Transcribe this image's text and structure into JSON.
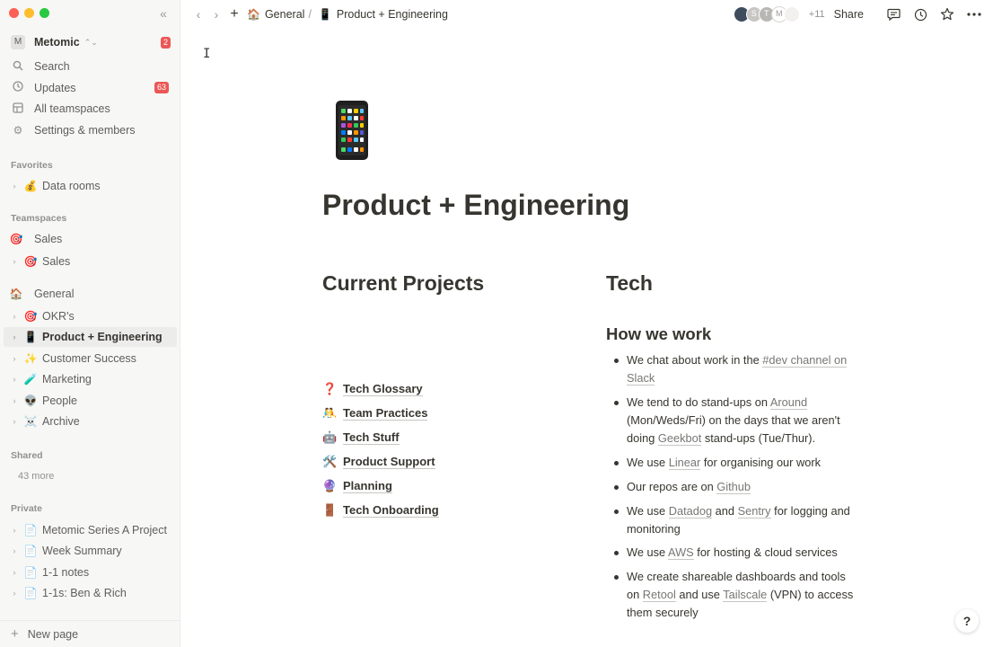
{
  "workspace": {
    "avatar": "M",
    "name": "Metomic",
    "badge": "2"
  },
  "sidebar": {
    "menu": [
      {
        "label": "Search",
        "icon": "search-icon"
      },
      {
        "label": "Updates",
        "icon": "clock-icon",
        "badge": "63"
      },
      {
        "label": "All teamspaces",
        "icon": "grid-icon"
      },
      {
        "label": "Settings & members",
        "icon": "gear-icon"
      }
    ],
    "favorites_label": "Favorites",
    "favorites": [
      {
        "emoji": "💰",
        "label": "Data rooms"
      }
    ],
    "teamspaces_label": "Teamspaces",
    "teamspaces": [
      {
        "emoji": "🎯",
        "label": "Sales"
      },
      {
        "emoji": "🎯",
        "label": "Sales"
      }
    ],
    "general": [
      {
        "emoji": "🏠",
        "label": "General"
      },
      {
        "emoji": "🎯",
        "label": "OKR's"
      },
      {
        "emoji": "📱",
        "label": "Product + Engineering"
      },
      {
        "emoji": "✨",
        "label": "Customer Success"
      },
      {
        "emoji": "🧪",
        "label": "Marketing"
      },
      {
        "emoji": "👽",
        "label": "People"
      },
      {
        "emoji": "☠️",
        "label": "Archive"
      }
    ],
    "shared_label": "Shared",
    "shared_more": "43 more",
    "private_label": "Private",
    "private": [
      {
        "emoji": "📄",
        "label": "Metomic Series A Project"
      },
      {
        "emoji": "📄",
        "label": "Week Summary"
      },
      {
        "emoji": "📄",
        "label": "1-1 notes"
      },
      {
        "emoji": "📄",
        "label": "1-1s: Ben & Rich"
      }
    ],
    "new_page": "New page"
  },
  "topbar": {
    "crumb_general_emoji": "🏠",
    "crumb_general": "General",
    "crumb_sep": "/",
    "crumb_page_emoji": "📱",
    "crumb_page": "Product + Engineering",
    "avatars": [
      "",
      "S",
      "T",
      "M",
      ""
    ],
    "more_count": "+11",
    "share": "Share"
  },
  "page": {
    "title": "Product + Engineering",
    "left_heading": "Current Projects",
    "right_heading": "Tech",
    "how_heading": "How we work",
    "links": [
      {
        "emoji": "❓",
        "label": "Tech Glossary"
      },
      {
        "emoji": "🤼",
        "label": "Team Practices"
      },
      {
        "emoji": "🤖",
        "label": "Tech Stuff"
      },
      {
        "emoji": "🛠️",
        "label": "Product Support"
      },
      {
        "emoji": "🔮",
        "label": "Planning"
      },
      {
        "emoji": "🚪",
        "label": "Tech Onboarding"
      }
    ],
    "bullets": {
      "b1_pre": "We chat about work in the ",
      "b1_link_bold": "#dev",
      "b1_link_rest": " channel on Slack",
      "b2_pre": "We tend to do stand-ups on ",
      "b2_link": "Around",
      "b2_mid": " (Mon/Weds/Fri) on the days that we aren't doing ",
      "b2_link2": "Geekbot",
      "b2_post": " stand-ups (Tue/Thur).",
      "b3_pre": "We use ",
      "b3_link": "Linear",
      "b3_post": " for organising our work",
      "b4_pre": "Our repos are on ",
      "b4_link": "Github",
      "b5_pre": "We use ",
      "b5_link": "Datadog",
      "b5_mid": " and ",
      "b5_link2": "Sentry",
      "b5_post": " for logging and monitoring",
      "b6_pre": "We use ",
      "b6_link": "AWS",
      "b6_post": " for hosting & cloud services",
      "b7_pre": "We create shareable dashboards and tools on ",
      "b7_link": "Retool",
      "b7_mid": " and use ",
      "b7_link2": "Tailscale",
      "b7_post": " (VPN) to access them securely"
    },
    "help": "?"
  }
}
